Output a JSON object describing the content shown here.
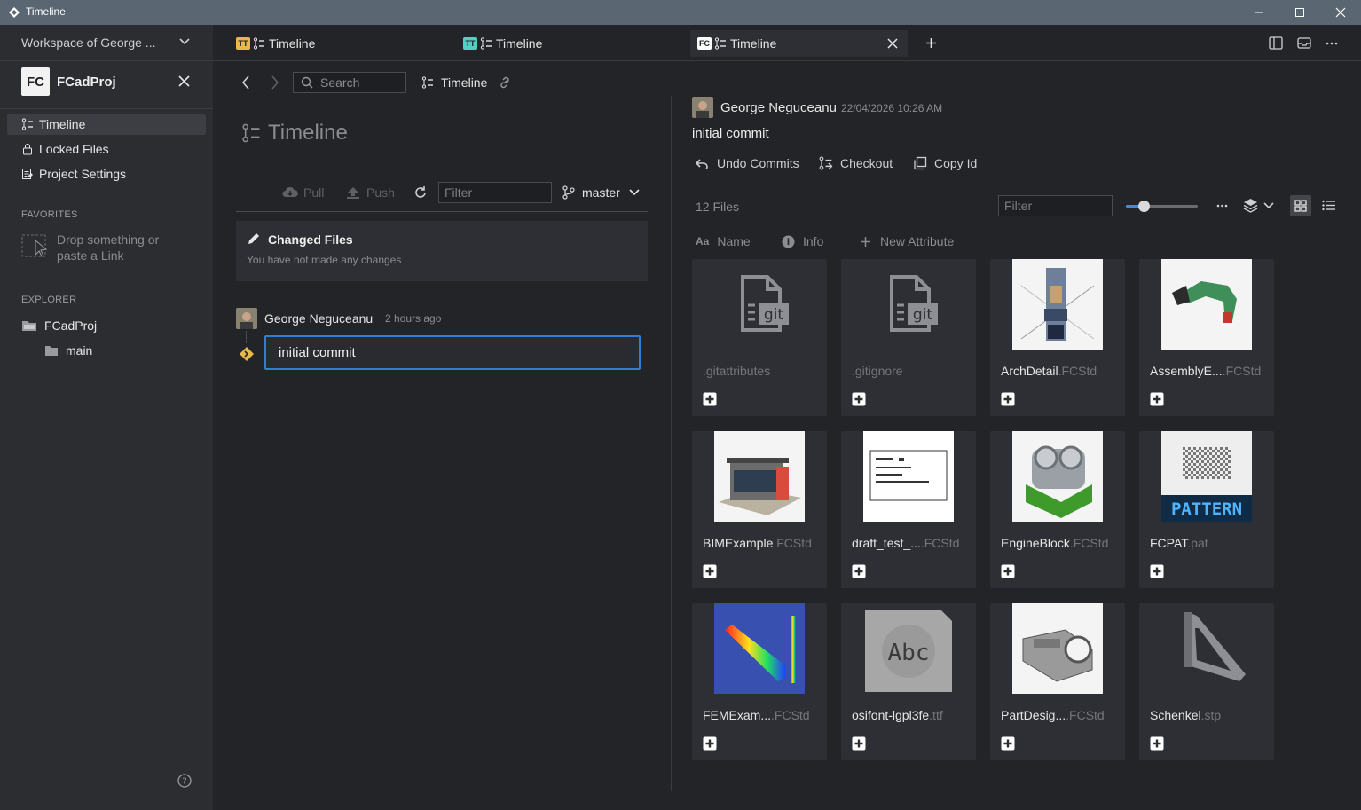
{
  "window": {
    "title": "Timeline"
  },
  "sidebar": {
    "workspace": "Workspace of George ...",
    "project": {
      "logo": "FC",
      "name": "FCadProj"
    },
    "nav": [
      {
        "label": "Timeline",
        "icon": "timeline-icon"
      },
      {
        "label": "Locked Files",
        "icon": "lock-icon"
      },
      {
        "label": "Project Settings",
        "icon": "settings-icon"
      }
    ],
    "favorites_title": "FAVORITES",
    "drop_hint": "Drop something or paste a Link",
    "explorer_title": "EXPLORER",
    "explorer": [
      {
        "label": "FCadProj",
        "icon": "folder-icon"
      },
      {
        "label": "main",
        "icon": "folder-icon"
      }
    ]
  },
  "tabs": [
    {
      "badge": "TT",
      "badge_color": "#e8b84a",
      "label": "Timeline"
    },
    {
      "badge": "TT",
      "badge_color": "#4fd1c5",
      "label": "Timeline"
    },
    {
      "badge": "FC",
      "badge_color": "#ffffff",
      "label": "Timeline"
    }
  ],
  "toolbar": {
    "search_placeholder": "Search",
    "crumb": "Timeline"
  },
  "timeline": {
    "title": "Timeline",
    "pull": "Pull",
    "push": "Push",
    "filter_placeholder": "Filter",
    "branch": "master",
    "changed_files_title": "Changed Files",
    "changed_files_sub": "You have not made any changes",
    "commit": {
      "author": "George Neguceanu",
      "when": "2 hours ago",
      "message": "initial commit"
    }
  },
  "detail": {
    "author": "George Neguceanu",
    "date": "22/04/2026 10:26 AM",
    "message": "initial commit",
    "actions": [
      "Undo Commits",
      "Checkout",
      "Copy Id"
    ],
    "file_count": "12 Files",
    "filter_placeholder": "Filter",
    "zoom_level": 0.25,
    "columns": [
      "Name",
      "Info",
      "New Attribute"
    ],
    "files": [
      {
        "name": "",
        "ext": ".gitattributes",
        "thumb": "git-file-icon"
      },
      {
        "name": "",
        "ext": ".gitignore",
        "thumb": "git-file-icon"
      },
      {
        "name": "ArchDetail",
        "ext": ".FCStd",
        "thumb": "arch-detail-thumbnail"
      },
      {
        "name": "AssemblyE...",
        "ext": ".FCStd",
        "thumb": "excavator-thumbnail"
      },
      {
        "name": "BIMExample",
        "ext": ".FCStd",
        "thumb": "building-thumbnail"
      },
      {
        "name": "draft_test_...",
        "ext": ".FCStd",
        "thumb": "drawing-thumbnail"
      },
      {
        "name": "EngineBlock",
        "ext": ".FCStd",
        "thumb": "engine-thumbnail"
      },
      {
        "name": "FCPAT",
        "ext": ".pat",
        "thumb": "pattern-thumbnail",
        "thumb_text": "PATTERN"
      },
      {
        "name": "FEMExam...",
        "ext": ".FCStd",
        "thumb": "fem-thumbnail"
      },
      {
        "name": "osifont-lgpl3fe",
        "ext": ".ttf",
        "thumb": "font-thumbnail",
        "thumb_text": "Abc"
      },
      {
        "name": "PartDesig...",
        "ext": ".FCStd",
        "thumb": "part-thumbnail"
      },
      {
        "name": "Schenkel",
        "ext": ".stp",
        "thumb": "bracket-thumbnail"
      }
    ]
  },
  "colors": {
    "accent": "#3d8be8",
    "focus_border": "#2f7fd8",
    "plus": "#ffffff",
    "commit_diamond": "#e8b84a"
  }
}
